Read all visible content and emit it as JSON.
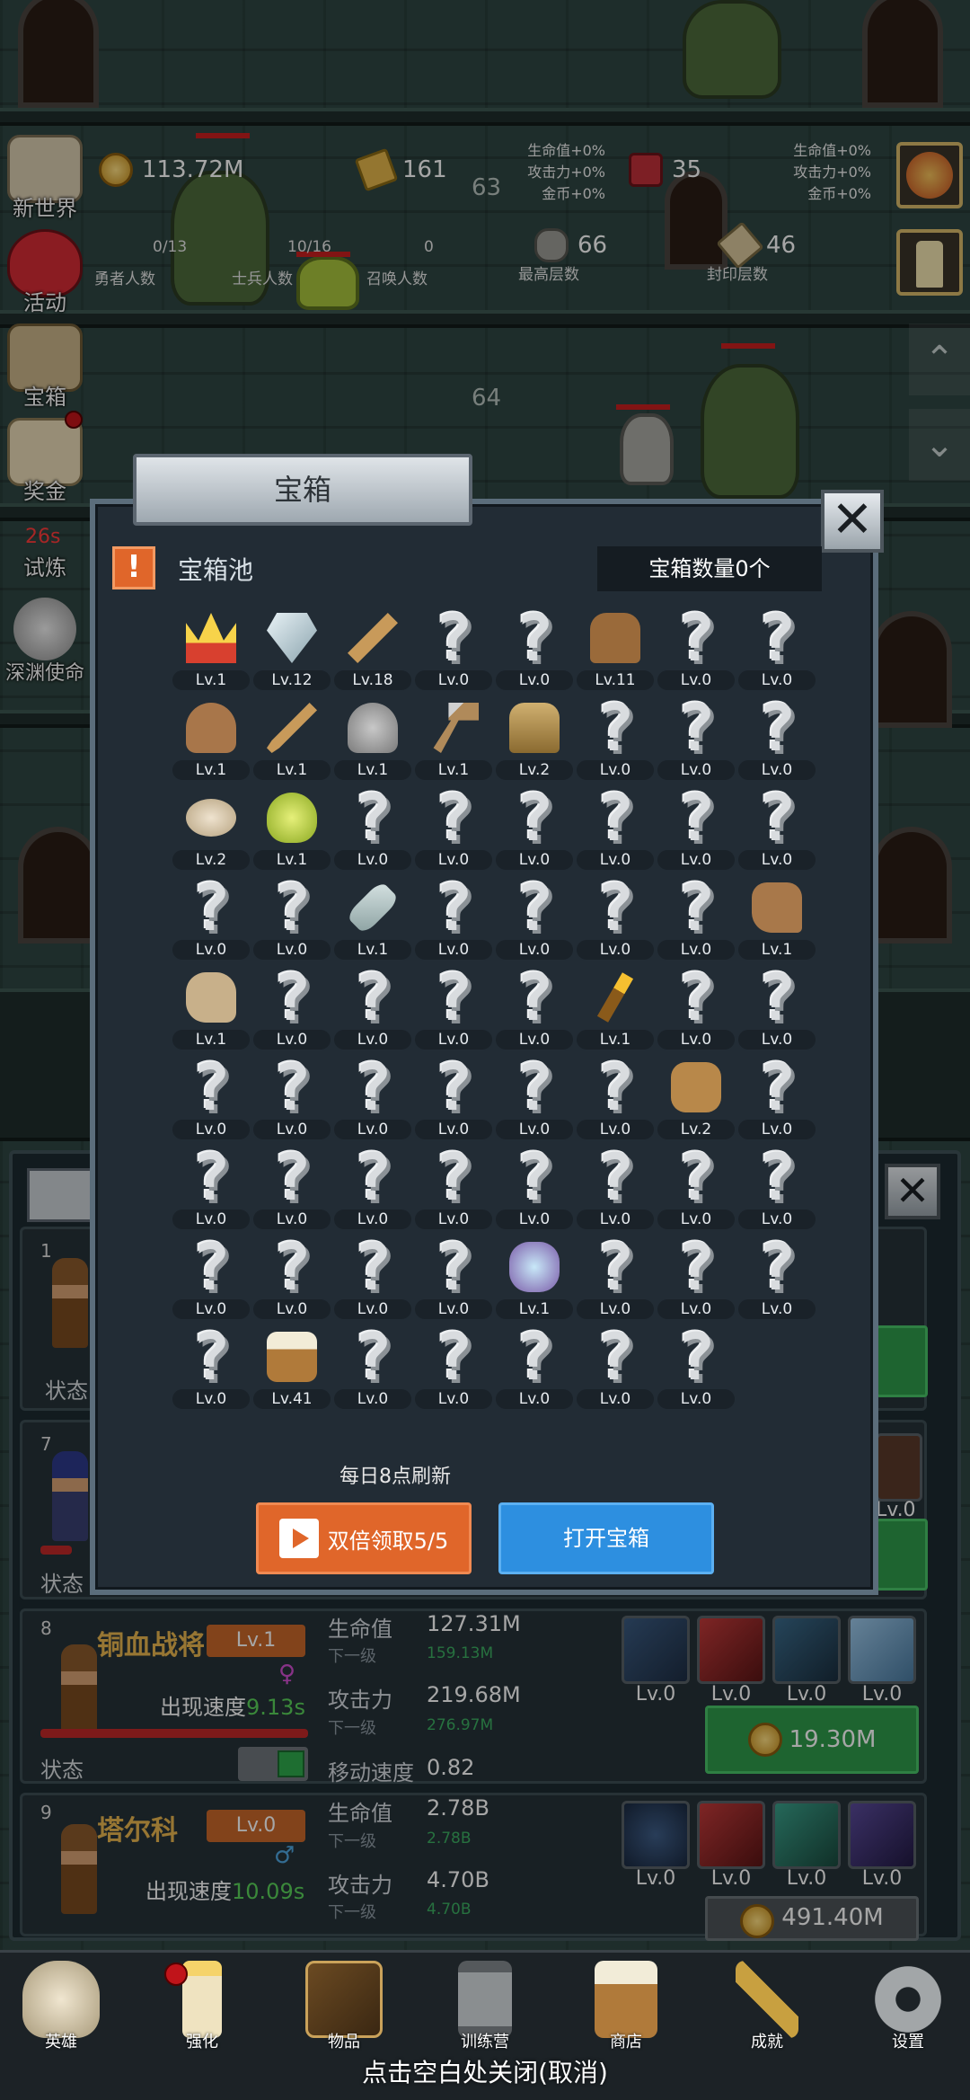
{
  "top_stats": {
    "coins": "113.72M",
    "gold_bars": "161",
    "gems": "35",
    "floor_63": "63",
    "floor_64": "64",
    "hero_count": "0/13",
    "hero_count_label": "勇者人数",
    "soldier_count": "10/16",
    "soldier_count_label": "士兵人数",
    "summon_count": "0",
    "summon_count_label": "召唤人数",
    "max_floor": "66",
    "max_floor_label": "最高层数",
    "seal_floor": "46",
    "seal_floor_label": "封印层数",
    "buff_hp": "生命值+0%",
    "buff_atk": "攻击力+0%",
    "buff_gold": "金币+0%"
  },
  "side_menu": {
    "new_world": "新世界",
    "event": "活动",
    "chest": "宝箱",
    "reward": "奖金",
    "trial_timer": "26s",
    "trial": "试炼",
    "abyss": "深渊使命"
  },
  "modal": {
    "title": "宝箱",
    "pool_label": "宝箱池",
    "chest_count": "宝箱数量0个",
    "refresh_note": "每日8点刷新",
    "double_button": "双倍领取5/5",
    "open_button": "打开宝箱",
    "close_icon": "✕",
    "items": [
      {
        "icon": "crown",
        "lv": "Lv.1"
      },
      {
        "icon": "diamond",
        "lv": "Lv.12"
      },
      {
        "icon": "wooden-sword",
        "lv": "Lv.18"
      },
      {
        "icon": "unknown",
        "lv": "Lv.0"
      },
      {
        "icon": "unknown",
        "lv": "Lv.0"
      },
      {
        "icon": "leather-armor",
        "lv": "Lv.11"
      },
      {
        "icon": "unknown",
        "lv": "Lv.0"
      },
      {
        "icon": "unknown",
        "lv": "Lv.0"
      },
      {
        "icon": "leather-helmet",
        "lv": "Lv.1"
      },
      {
        "icon": "dagger",
        "lv": "Lv.1"
      },
      {
        "icon": "knight-helmet",
        "lv": "Lv.1"
      },
      {
        "icon": "hammer",
        "lv": "Lv.1"
      },
      {
        "icon": "great-helm",
        "lv": "Lv.2"
      },
      {
        "icon": "unknown",
        "lv": "Lv.0"
      },
      {
        "icon": "unknown",
        "lv": "Lv.0"
      },
      {
        "icon": "unknown",
        "lv": "Lv.0"
      },
      {
        "icon": "bread",
        "lv": "Lv.2"
      },
      {
        "icon": "potion",
        "lv": "Lv.1"
      },
      {
        "icon": "unknown",
        "lv": "Lv.0"
      },
      {
        "icon": "unknown",
        "lv": "Lv.0"
      },
      {
        "icon": "unknown",
        "lv": "Lv.0"
      },
      {
        "icon": "unknown",
        "lv": "Lv.0"
      },
      {
        "icon": "unknown",
        "lv": "Lv.0"
      },
      {
        "icon": "unknown",
        "lv": "Lv.0"
      },
      {
        "icon": "unknown",
        "lv": "Lv.0"
      },
      {
        "icon": "unknown",
        "lv": "Lv.0"
      },
      {
        "icon": "bottle",
        "lv": "Lv.1"
      },
      {
        "icon": "unknown",
        "lv": "Lv.0"
      },
      {
        "icon": "unknown",
        "lv": "Lv.0"
      },
      {
        "icon": "unknown",
        "lv": "Lv.0"
      },
      {
        "icon": "unknown",
        "lv": "Lv.0"
      },
      {
        "icon": "boot",
        "lv": "Lv.1"
      },
      {
        "icon": "shoe",
        "lv": "Lv.1"
      },
      {
        "icon": "unknown",
        "lv": "Lv.0"
      },
      {
        "icon": "unknown",
        "lv": "Lv.0"
      },
      {
        "icon": "unknown",
        "lv": "Lv.0"
      },
      {
        "icon": "unknown",
        "lv": "Lv.0"
      },
      {
        "icon": "torch",
        "lv": "Lv.1"
      },
      {
        "icon": "unknown",
        "lv": "Lv.0"
      },
      {
        "icon": "unknown",
        "lv": "Lv.0"
      },
      {
        "icon": "unknown",
        "lv": "Lv.0"
      },
      {
        "icon": "unknown",
        "lv": "Lv.0"
      },
      {
        "icon": "unknown",
        "lv": "Lv.0"
      },
      {
        "icon": "unknown",
        "lv": "Lv.0"
      },
      {
        "icon": "unknown",
        "lv": "Lv.0"
      },
      {
        "icon": "unknown",
        "lv": "Lv.0"
      },
      {
        "icon": "backpack",
        "lv": "Lv.2"
      },
      {
        "icon": "unknown",
        "lv": "Lv.0"
      },
      {
        "icon": "unknown",
        "lv": "Lv.0"
      },
      {
        "icon": "unknown",
        "lv": "Lv.0"
      },
      {
        "icon": "unknown",
        "lv": "Lv.0"
      },
      {
        "icon": "unknown",
        "lv": "Lv.0"
      },
      {
        "icon": "unknown",
        "lv": "Lv.0"
      },
      {
        "icon": "unknown",
        "lv": "Lv.0"
      },
      {
        "icon": "unknown",
        "lv": "Lv.0"
      },
      {
        "icon": "unknown",
        "lv": "Lv.0"
      },
      {
        "icon": "unknown",
        "lv": "Lv.0"
      },
      {
        "icon": "unknown",
        "lv": "Lv.0"
      },
      {
        "icon": "unknown",
        "lv": "Lv.0"
      },
      {
        "icon": "unknown",
        "lv": "Lv.0"
      },
      {
        "icon": "gem-cluster",
        "lv": "Lv.1"
      },
      {
        "icon": "unknown",
        "lv": "Lv.0"
      },
      {
        "icon": "unknown",
        "lv": "Lv.0"
      },
      {
        "icon": "unknown",
        "lv": "Lv.0"
      },
      {
        "icon": "unknown",
        "lv": "Lv.0"
      },
      {
        "icon": "beer-mug",
        "lv": "Lv.41"
      },
      {
        "icon": "unknown",
        "lv": "Lv.0"
      },
      {
        "icon": "unknown",
        "lv": "Lv.0"
      },
      {
        "icon": "unknown",
        "lv": "Lv.0"
      },
      {
        "icon": "unknown",
        "lv": "Lv.0"
      },
      {
        "icon": "unknown",
        "lv": "Lv.0"
      }
    ]
  },
  "heroes": {
    "card1_num": "1",
    "card1_status": "状态",
    "card7_num": "7",
    "card7_status": "状态",
    "card7_skill_lv": "Lv.0",
    "card8": {
      "num": "8",
      "name": "铜血战将",
      "lv": "Lv.1",
      "speed_label": "出现速度",
      "speed": "9.13s",
      "hp_label": "生命值",
      "hp": "127.31M",
      "next_label": "下一级",
      "hp_next": "159.13M",
      "atk_label": "攻击力",
      "atk": "219.68M",
      "atk_next": "276.97M",
      "move_label": "移动速度",
      "move": "0.82",
      "status": "状态",
      "cost": "19.30M",
      "skills": [
        "Lv.0",
        "Lv.0",
        "Lv.0",
        "Lv.0"
      ]
    },
    "card9": {
      "num": "9",
      "name": "塔尔科",
      "lv": "Lv.0",
      "speed_label": "出现速度",
      "speed": "10.09s",
      "hp_label": "生命值",
      "hp": "2.78B",
      "next_label": "下一级",
      "hp_next": "2.78B",
      "atk_label": "攻击力",
      "atk": "4.70B",
      "atk_next": "4.70B",
      "cost": "491.40M",
      "skills": [
        "Lv.0",
        "Lv.0",
        "Lv.0",
        "Lv.0"
      ]
    }
  },
  "bottom_nav": {
    "hero": "英雄",
    "upgrade": "强化",
    "items": "物品",
    "training": "训练营",
    "shop": "商店",
    "achievement": "成就",
    "settings": "设置"
  },
  "hint": "点击空白处关闭(取消)",
  "colors": {
    "accent_orange": "#e0662a",
    "accent_blue": "#2d8fe0",
    "gold_text": "#e9b64f",
    "green_btn": "#2f9a4b",
    "speed_green": "#5ad25a"
  }
}
